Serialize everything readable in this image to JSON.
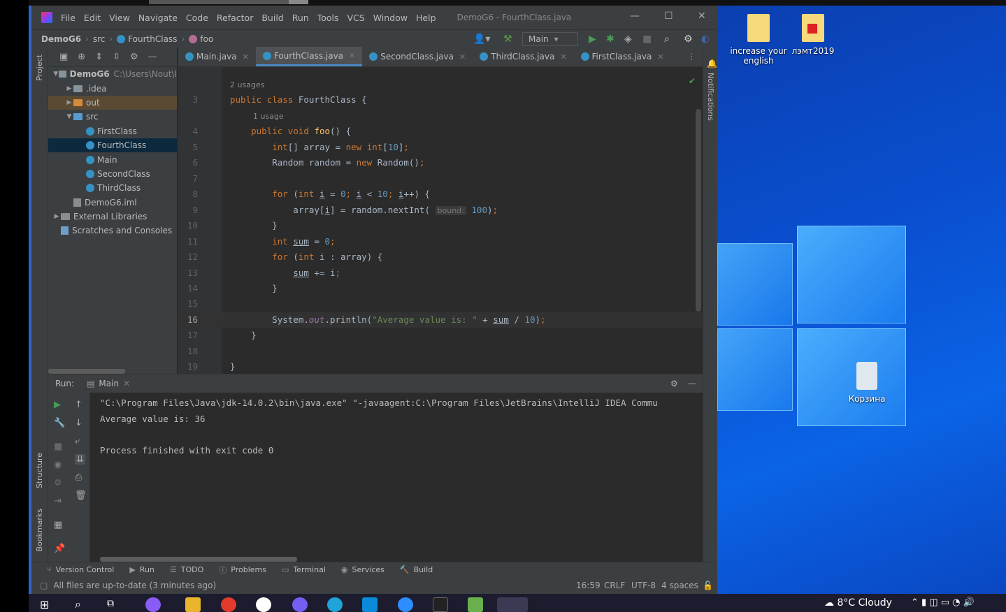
{
  "window": {
    "title": "DemoG6 - FourthClass.java"
  },
  "menu": [
    "File",
    "Edit",
    "View",
    "Navigate",
    "Code",
    "Refactor",
    "Build",
    "Run",
    "Tools",
    "VCS",
    "Window",
    "Help"
  ],
  "breadcrumbs": {
    "project": "DemoG6",
    "dir": "src",
    "cls": "FourthClass",
    "method": "foo"
  },
  "run_config": "Main",
  "project_strip_label": "Project",
  "structure_label": "Structure",
  "bookmarks_label": "Bookmarks",
  "notifications_label": "Notifications",
  "project_tree": [
    {
      "label": "DemoG6",
      "extra": "C:\\Users\\Nout\\I",
      "level": 0,
      "arrow": "down",
      "icon": "folder"
    },
    {
      "label": ".idea",
      "level": 1,
      "arrow": "right",
      "icon": "folder"
    },
    {
      "label": "out",
      "level": 1,
      "arrow": "right",
      "icon": "folder-orange"
    },
    {
      "label": "src",
      "level": 1,
      "arrow": "down",
      "icon": "folder-blue"
    },
    {
      "label": "FirstClass",
      "level": 2,
      "icon": "class"
    },
    {
      "label": "FourthClass",
      "level": 2,
      "icon": "class"
    },
    {
      "label": "Main",
      "level": 2,
      "icon": "class"
    },
    {
      "label": "SecondClass",
      "level": 2,
      "icon": "class"
    },
    {
      "label": "ThirdClass",
      "level": 2,
      "icon": "class"
    },
    {
      "label": "DemoG6.iml",
      "level": 1,
      "icon": "file"
    },
    {
      "label": "External Libraries",
      "level": 0,
      "arrow": "right",
      "icon": "lib"
    },
    {
      "label": "Scratches and Consoles",
      "level": 0,
      "icon": "scratch"
    }
  ],
  "tabs": [
    "Main.java",
    "FourthClass.java",
    "SecondClass.java",
    "ThirdClass.java",
    "FirstClass.java"
  ],
  "editor": {
    "hint_usages2": "2 usages",
    "hint_usage1": "1 usage",
    "line_numbers": [
      "3",
      "4",
      "5",
      "6",
      "7",
      "8",
      "9",
      "10",
      "11",
      "12",
      "13",
      "14",
      "15",
      "16",
      "17",
      "18",
      "19"
    ],
    "inlay_bound": "bound:"
  },
  "run": {
    "label": "Run:",
    "tab": "Main",
    "console": [
      "\"C:\\Program Files\\Java\\jdk-14.0.2\\bin\\java.exe\" \"-javaagent:C:\\Program Files\\JetBrains\\IntelliJ IDEA Commu",
      "Average value is: 36",
      "",
      "Process finished with exit code 0"
    ]
  },
  "toolwindows": [
    "Version Control",
    "Run",
    "TODO",
    "Problems",
    "Terminal",
    "Services",
    "Build"
  ],
  "status": {
    "message": "All files are up-to-date (3 minutes ago)",
    "pos": "16:59",
    "eol": "CRLF",
    "enc": "UTF-8",
    "indent": "4 spaces"
  },
  "desktop": {
    "icon1": "increase your english",
    "icon2": "лэмт2019",
    "bin": "Корзина"
  },
  "taskbar": {
    "weather": "8°C  Cloudy"
  },
  "colors": {
    "accent": "#2f65ca",
    "keyword": "#cc7832",
    "number": "#6897bb",
    "string": "#6a8759",
    "field": "#9876aa"
  }
}
